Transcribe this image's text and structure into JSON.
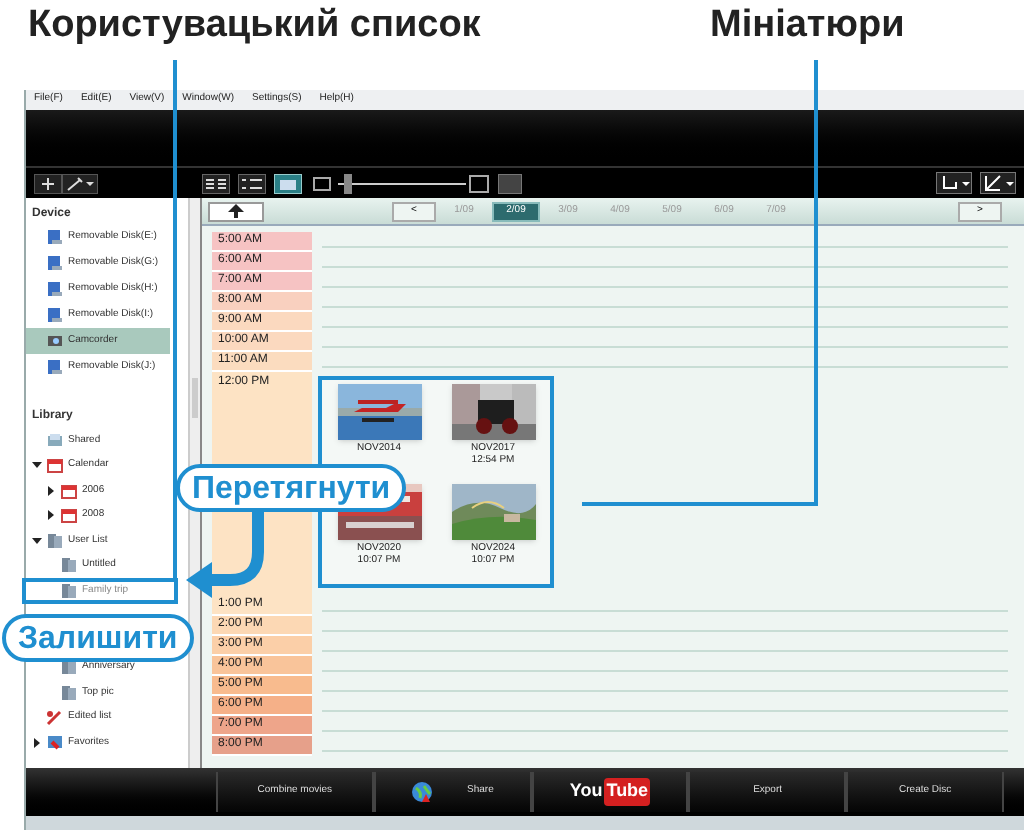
{
  "callouts": {
    "user_list": "Користувацький список",
    "thumbnails": "Мініатюри",
    "drag": "Перетягнути",
    "drop": "Залишити"
  },
  "menu": [
    "File(F)",
    "Edit(E)",
    "View(V)",
    "Window(W)",
    "Settings(S)",
    "Help(H)"
  ],
  "device": {
    "title": "Device",
    "items": [
      {
        "label": "Removable Disk(E:)",
        "selected": false
      },
      {
        "label": "Removable Disk(G:)",
        "selected": false
      },
      {
        "label": "Removable Disk(H:)",
        "selected": false
      },
      {
        "label": "Removable Disk(I:)",
        "selected": false
      },
      {
        "label": "Camcorder",
        "selected": true
      },
      {
        "label": "Removable Disk(J:)",
        "selected": false
      }
    ]
  },
  "library": {
    "title": "Library",
    "items": [
      {
        "label": "Shared",
        "kind": "shared"
      },
      {
        "label": "Calendar",
        "kind": "calendar",
        "expanded": true,
        "children": [
          {
            "label": "2006",
            "kind": "calendar",
            "expanded": false
          },
          {
            "label": "2008",
            "kind": "calendar",
            "expanded": false
          }
        ]
      },
      {
        "label": "User List",
        "kind": "list",
        "expanded": true,
        "children": [
          {
            "label": "Untitled",
            "kind": "list"
          },
          {
            "label": "Family trip",
            "kind": "list",
            "highlighted": true
          },
          {
            "label": "Anniversary",
            "kind": "list"
          },
          {
            "label": "Top pic",
            "kind": "list"
          }
        ]
      },
      {
        "label": "Edited list",
        "kind": "edited"
      },
      {
        "label": "Favorites",
        "kind": "favorites",
        "expanded": false
      }
    ]
  },
  "nav": {
    "months": [
      {
        "label": "1/09",
        "selected": false
      },
      {
        "label": "2/09",
        "selected": true
      },
      {
        "label": "3/09",
        "selected": false
      },
      {
        "label": "4/09",
        "selected": false
      },
      {
        "label": "5/09",
        "selected": false
      },
      {
        "label": "6/09",
        "selected": false
      },
      {
        "label": "7/09",
        "selected": false
      }
    ],
    "prev": "<",
    "next": ">"
  },
  "hours_am": [
    "5:00 AM",
    "6:00 AM",
    "7:00 AM",
    "8:00 AM",
    "9:00 AM",
    "10:00 AM",
    "11:00 AM",
    "12:00 PM"
  ],
  "zoom": {
    "level": 0.05
  },
  "thumbnails": [
    {
      "lines": [
        "NOV2014"
      ]
    },
    {
      "lines": [
        "NOV2017",
        "12:54 PM"
      ]
    },
    {
      "lines": [
        "NOV2020",
        "10:07 PM"
      ]
    },
    {
      "lines": [
        "NOV2024",
        "10:07 PM"
      ]
    }
  ],
  "hours_pm": [
    "1:00 PM",
    "2:00 PM",
    "3:00 PM",
    "4:00 PM",
    "5:00 PM",
    "6:00 PM",
    "7:00 PM",
    "8:00 PM"
  ],
  "bottom": [
    {
      "label": "Combine movies",
      "kind": "text"
    },
    {
      "label": "Share",
      "kind": "globe"
    },
    {
      "label": "You",
      "label2": "Tube",
      "kind": "youtube"
    },
    {
      "label": "Export",
      "kind": "text"
    },
    {
      "label": "Create Disc",
      "kind": "text"
    }
  ]
}
